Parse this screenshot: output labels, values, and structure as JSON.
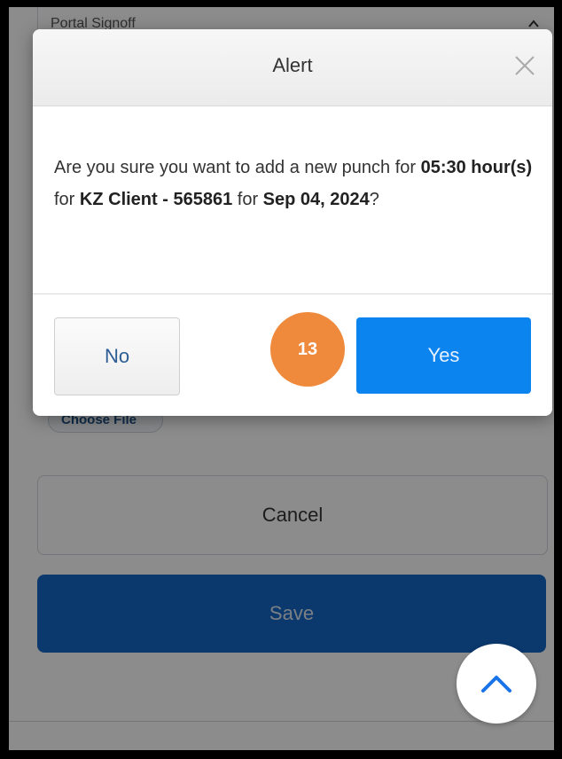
{
  "background": {
    "select_label": "Portal Signoff",
    "choose_file_label": "Choose File",
    "cancel_label": "Cancel",
    "save_label": "Save"
  },
  "alert": {
    "title": "Alert",
    "message": {
      "prefix": "Are you sure you want to add a new punch for ",
      "hours": "05:30 hour(s)",
      "mid1": " for ",
      "client": "KZ Client - 565861",
      "mid2": " for ",
      "date": "Sep 04, 2024",
      "suffix": "?"
    },
    "no_label": "No",
    "yes_label": "Yes",
    "step_badge": "13"
  },
  "icons": {
    "close": "close-icon",
    "scroll_top": "chevron-up-icon",
    "select_chevron": "chevron-up-icon"
  },
  "colors": {
    "primary_blue": "#0b84f0",
    "save_blue": "#1467c7",
    "badge_orange": "#ef8a3c"
  }
}
